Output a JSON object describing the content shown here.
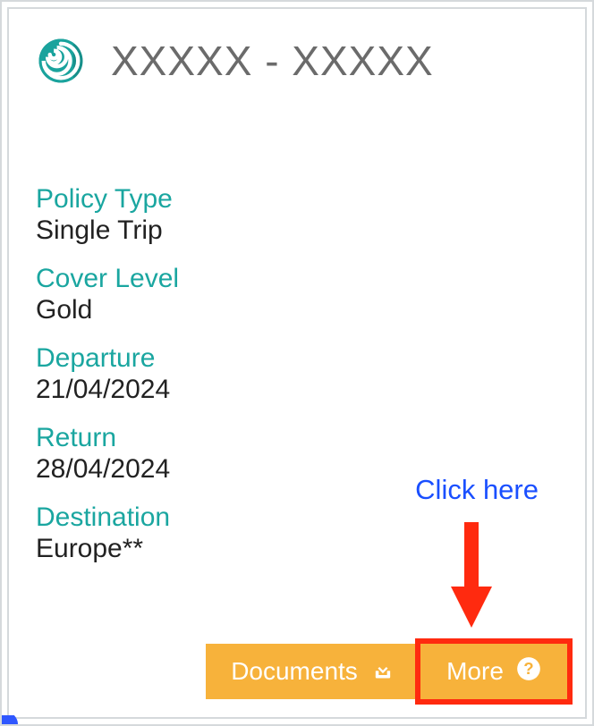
{
  "header": {
    "title": "XXXXX - XXXXX"
  },
  "fields": {
    "policy_type": {
      "label": "Policy Type",
      "value": "Single Trip"
    },
    "cover_level": {
      "label": "Cover Level",
      "value": "Gold"
    },
    "departure": {
      "label": "Departure",
      "value": "21/04/2024"
    },
    "return": {
      "label": "Return",
      "value": "28/04/2024"
    },
    "destination": {
      "label": "Destination",
      "value": "Europe**"
    }
  },
  "actions": {
    "documents_label": "Documents",
    "more_label": "More"
  },
  "annotation": {
    "click_here": "Click here"
  },
  "colors": {
    "teal": "#1aa6a0",
    "orange": "#f7b23b",
    "red": "#ff2a0f",
    "blue": "#1a4fff"
  }
}
